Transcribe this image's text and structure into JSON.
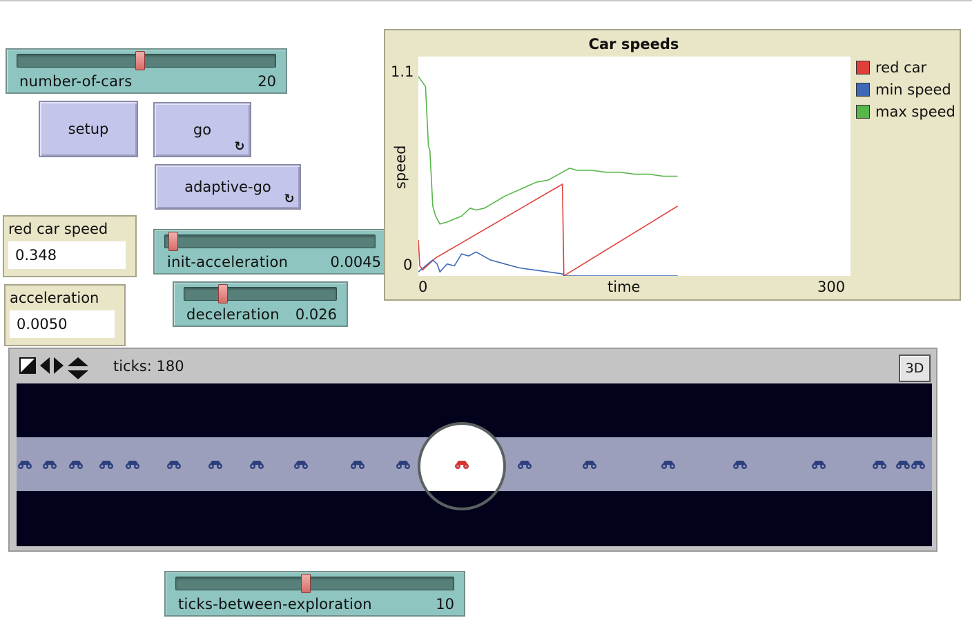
{
  "sliders": {
    "number_of_cars": {
      "label": "number-of-cars",
      "value": "20"
    },
    "init_acceleration": {
      "label": "init-acceleration",
      "value": "0.0045"
    },
    "deceleration": {
      "label": "deceleration",
      "value": "0.026"
    },
    "ticks_between_exploration": {
      "label": "ticks-between-exploration",
      "value": "10"
    }
  },
  "buttons": {
    "setup": "setup",
    "go": "go",
    "adaptive_go": "adaptive-go"
  },
  "monitors": {
    "red_car_speed": {
      "label": "red car speed",
      "value": "0.348"
    },
    "acceleration": {
      "label": "acceleration",
      "value": "0.0050"
    }
  },
  "plot": {
    "title": "Car speeds",
    "ymax": "1.1",
    "ymin": "0",
    "xmin": "0",
    "xmax": "300",
    "xlabel": "time",
    "ylabel": "speed",
    "legend": [
      {
        "name": "red car",
        "color": "#e0403a"
      },
      {
        "name": "min speed",
        "color": "#3f69b8"
      },
      {
        "name": "max speed",
        "color": "#58b64a"
      }
    ]
  },
  "chart_data": {
    "type": "line",
    "title": "Car speeds",
    "xlabel": "time",
    "ylabel": "speed",
    "xlim": [
      0,
      300
    ],
    "ylim": [
      0,
      1.1
    ],
    "series": [
      {
        "name": "red car",
        "color": "#e0403a",
        "x": [
          0,
          1,
          3,
          12,
          100,
          101,
          180
        ],
        "y": [
          0.18,
          0.05,
          0.03,
          0.09,
          0.46,
          0.0,
          0.35
        ]
      },
      {
        "name": "min speed",
        "color": "#3f69b8",
        "x": [
          0,
          5,
          10,
          13,
          15,
          20,
          25,
          30,
          35,
          40,
          45,
          50,
          60,
          70,
          80,
          90,
          100,
          101,
          120,
          150,
          180
        ],
        "y": [
          0.02,
          0.05,
          0.08,
          0.06,
          0.02,
          0.06,
          0.05,
          0.11,
          0.1,
          0.12,
          0.1,
          0.08,
          0.06,
          0.04,
          0.03,
          0.02,
          0.01,
          0.0,
          0.0,
          0.0,
          0.0
        ]
      },
      {
        "name": "max speed",
        "color": "#58b64a",
        "x": [
          0,
          5,
          7,
          8,
          10,
          12,
          15,
          20,
          30,
          36,
          40,
          46,
          60,
          82,
          90,
          100,
          105,
          110,
          120,
          130,
          140,
          150,
          160,
          170,
          180
        ],
        "y": [
          1.0,
          0.95,
          0.65,
          0.63,
          0.35,
          0.3,
          0.26,
          0.27,
          0.3,
          0.34,
          0.33,
          0.34,
          0.4,
          0.47,
          0.48,
          0.52,
          0.54,
          0.53,
          0.53,
          0.52,
          0.52,
          0.51,
          0.51,
          0.5,
          0.5
        ]
      }
    ],
    "grid": false,
    "legend": "right"
  },
  "view": {
    "ticks": "ticks: 180",
    "btn_3d": "3D",
    "car_color": "#2c3f7e",
    "red_car_color": "#d8322c",
    "road_color": "#9c9fbb",
    "background_color": "#02021c"
  }
}
